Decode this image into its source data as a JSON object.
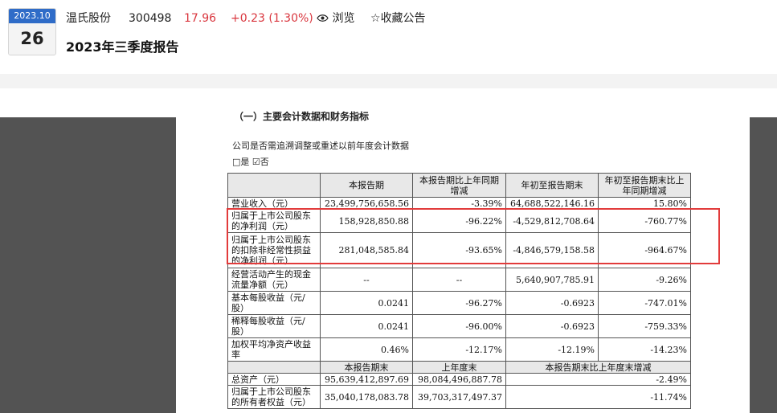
{
  "header": {
    "date_month": "2023.10",
    "date_day": "26",
    "company": "温氏股份",
    "code": "300498",
    "price": "17.96",
    "change": "+0.23 (1.30%)",
    "view_label": "浏览",
    "favorite_label": "收藏公告",
    "title": "2023年三季度报告",
    "price_color": "#d9363e"
  },
  "document": {
    "section_heading": "（一）主要会计数据和财务指标",
    "question": "公司是否需追溯调整或重述以前年度会计数据",
    "answer": "□是 ☑否"
  },
  "table": {
    "header1": [
      "",
      "本报告期",
      "本报告期比上年同期增减",
      "年初至报告期末",
      "年初至报告期末比上年同期增减"
    ],
    "rows1": [
      [
        "营业收入（元）",
        "23,499,756,658.56",
        "-3.39%",
        "64,688,522,146.16",
        "15.80%"
      ],
      [
        "归属于上市公司股东的净利润（元）",
        "158,928,850.88",
        "-96.22%",
        "-4,529,812,708.64",
        "-760.77%"
      ],
      [
        "归属于上市公司股东的扣除非经常性损益的净利润（元）",
        "281,048,585.84",
        "-93.65%",
        "-4,846,579,158.58",
        "-964.67%"
      ],
      [
        "经营活动产生的现金流量净额（元）",
        "--",
        "--",
        "5,640,907,785.91",
        "-9.26%"
      ],
      [
        "基本每股收益（元/股）",
        "0.0241",
        "-96.27%",
        "-0.6923",
        "-747.01%"
      ],
      [
        "稀释每股收益（元/股）",
        "0.0241",
        "-96.00%",
        "-0.6923",
        "-759.33%"
      ],
      [
        "加权平均净资产收益率",
        "0.46%",
        "-12.17%",
        "-12.19%",
        "-14.23%"
      ]
    ],
    "header2": [
      "",
      "本报告期末",
      "上年度末",
      "本报告期末比上年度末增减"
    ],
    "rows2": [
      [
        "总资产（元）",
        "95,639,412,897.69",
        "98,084,496,887.78",
        "-2.49%"
      ],
      [
        "归属于上市公司股东的所有者权益（元）",
        "35,040,178,083.78",
        "39,703,317,497.37",
        "-11.74%"
      ]
    ]
  }
}
